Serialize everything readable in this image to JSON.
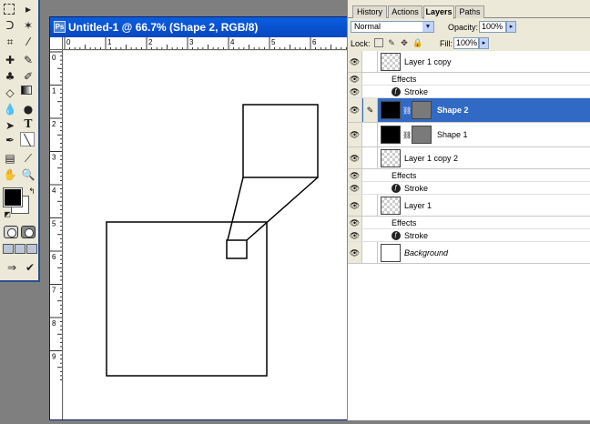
{
  "document": {
    "title": "Untitled-1 @ 66.7% (Shape 2, RGB/8)",
    "app_icon": "Ps",
    "ruler_h": [
      "0",
      "1",
      "2",
      "3",
      "4",
      "5",
      "6"
    ],
    "ruler_v": [
      "0",
      "1",
      "2",
      "3",
      "4",
      "5",
      "6",
      "7",
      "8",
      "9"
    ]
  },
  "panel": {
    "tabs": [
      {
        "label": "History",
        "active": false
      },
      {
        "label": "Actions",
        "active": false
      },
      {
        "label": "Layers",
        "active": true
      },
      {
        "label": "Paths",
        "active": false
      }
    ],
    "blend_mode": "Normal",
    "opacity_label": "Opacity:",
    "opacity": "100%",
    "lock_label": "Lock:",
    "fill_label": "Fill:",
    "fill": "100%"
  },
  "layers": [
    {
      "name": "Layer 1 copy",
      "thumb": "checker",
      "selected": false
    },
    {
      "name": "Effects",
      "kind": "effects"
    },
    {
      "name": "Stroke",
      "kind": "effect"
    },
    {
      "name": "Shape 2",
      "thumb": "black",
      "mask": true,
      "selected": true
    },
    {
      "name": "Shape 1",
      "thumb": "black",
      "mask": true,
      "selected": false
    },
    {
      "name": "Layer 1 copy 2",
      "thumb": "checker",
      "selected": false
    },
    {
      "name": "Effects",
      "kind": "effects"
    },
    {
      "name": "Stroke",
      "kind": "effect"
    },
    {
      "name": "Layer 1",
      "thumb": "checker",
      "selected": false
    },
    {
      "name": "Effects",
      "kind": "effects"
    },
    {
      "name": "Stroke",
      "kind": "effect"
    },
    {
      "name": "Background",
      "thumb": "white",
      "selected": false,
      "italic": true
    }
  ],
  "icons": {
    "visibility": "eye-icon",
    "brush": "brush-icon",
    "link": "chain-link-icon",
    "effect": "fx-icon"
  }
}
